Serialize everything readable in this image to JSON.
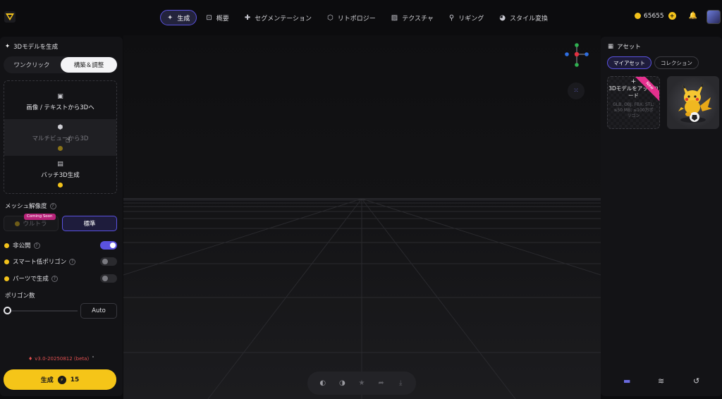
{
  "nav": {
    "items": [
      {
        "label": "生成",
        "icon": "sparkle-icon",
        "active": true
      },
      {
        "label": "概要",
        "icon": "focus-icon",
        "active": false
      },
      {
        "label": "セグメンテーション",
        "icon": "puzzle-icon",
        "active": false
      },
      {
        "label": "リトポロジー",
        "icon": "polyhedron-icon",
        "active": false
      },
      {
        "label": "テクスチャ",
        "icon": "texture-icon",
        "active": false
      },
      {
        "label": "リギング",
        "icon": "figure-icon",
        "active": false
      },
      {
        "label": "スタイル変換",
        "icon": "palette-icon",
        "active": false
      }
    ],
    "credits": "65655"
  },
  "left": {
    "title": "3Dモデルを生成",
    "tabs": {
      "one_click": "ワンクリック",
      "build_adjust": "構築＆調整"
    },
    "modes": {
      "image_text": "画像 / テキストから3Dへ",
      "multiview": "マルチビューから3D",
      "batch": "バッチ3D生成"
    },
    "mesh_resolution": {
      "label": "メッシュ解像度",
      "ultra": "ウルトラ",
      "coming_soon": "Coming Soon",
      "standard": "標準"
    },
    "toggles": {
      "private": "非公開",
      "smart_low_poly": "スマート低ポリゴン",
      "generate_parts": "パーツで生成"
    },
    "polygon_count": {
      "label": "ポリゴン数",
      "value": "Auto",
      "slider_fraction": 0
    },
    "version": "v3.0-20250812 (beta)",
    "generate": {
      "label": "生成",
      "cost": "15"
    }
  },
  "right": {
    "title": "アセット",
    "chips": {
      "my_assets": "マイアセット",
      "collection": "コレクション"
    },
    "upload": {
      "title": "3Dモデルをアップロード",
      "formats": "GLB, OBJ, FBX, STL; ≤50 MB; ≤100万ポリゴン",
      "badge": "New"
    }
  }
}
